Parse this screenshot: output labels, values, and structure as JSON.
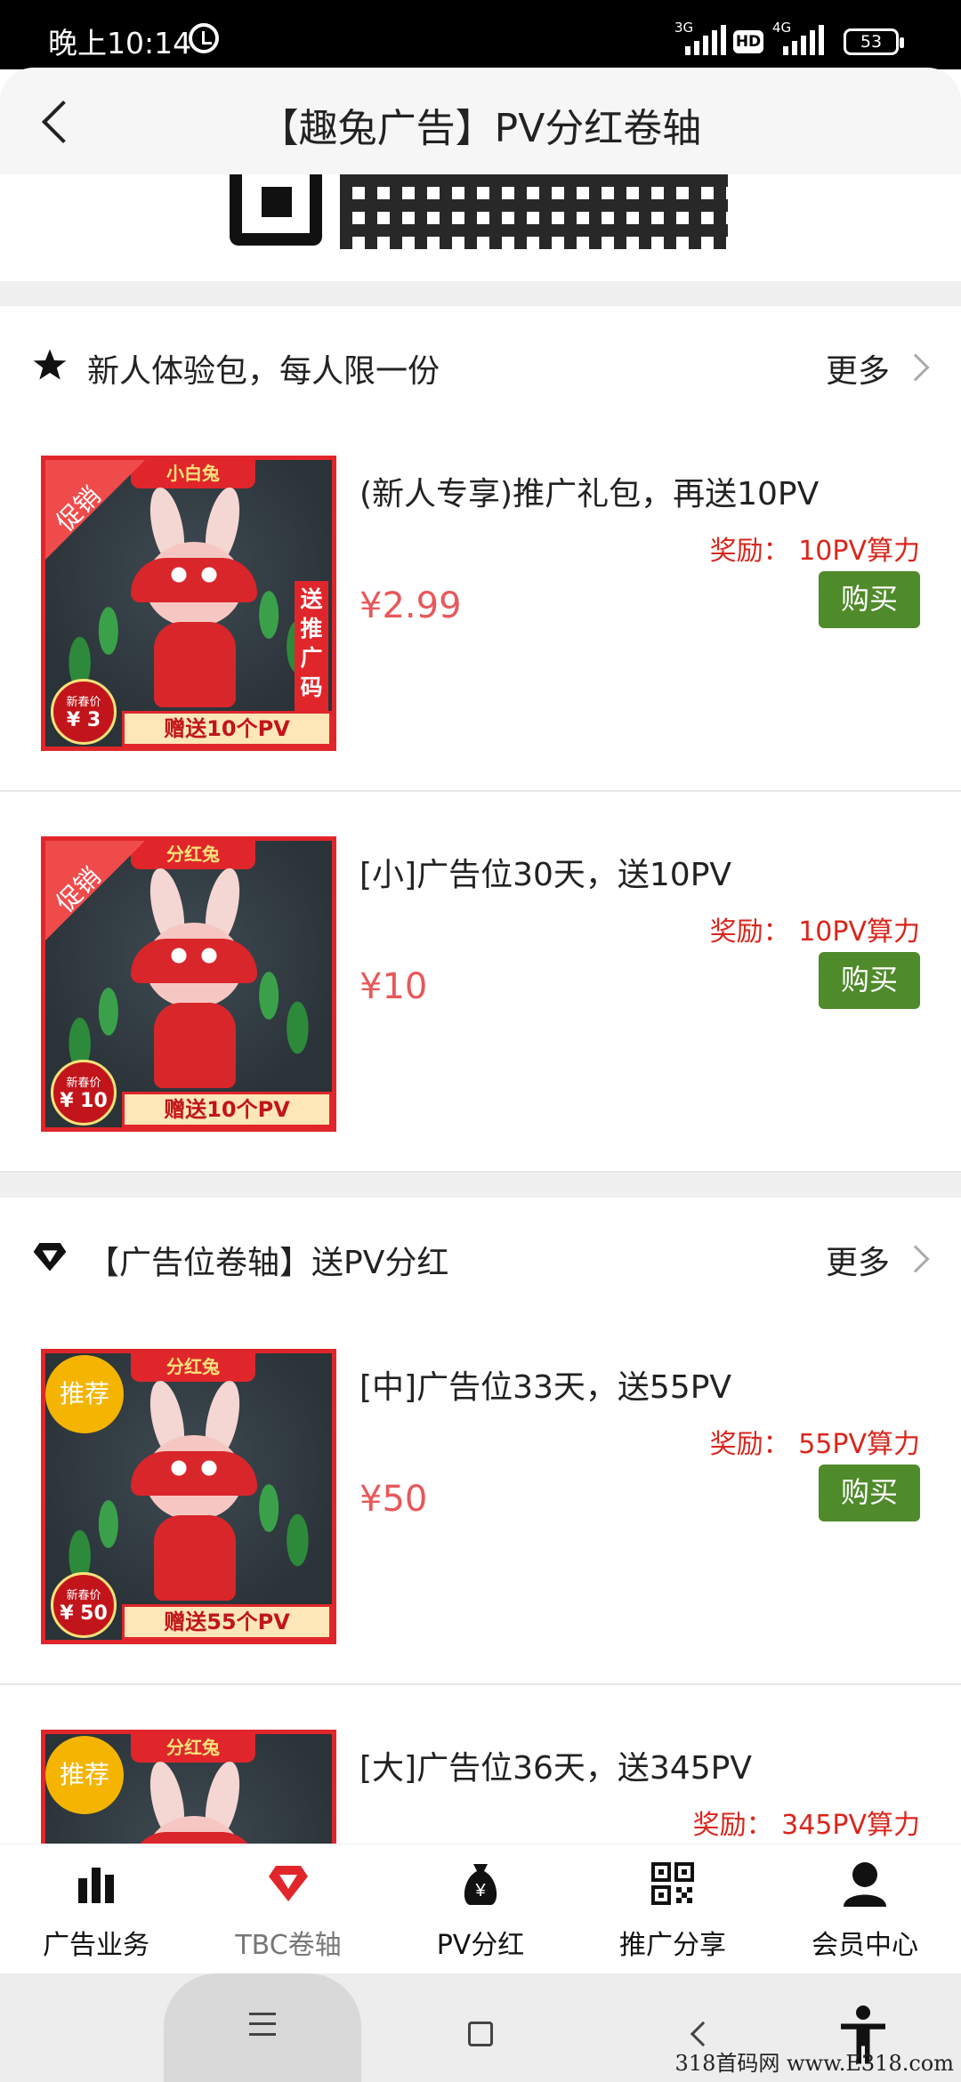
{
  "status_bar": {
    "time": "晚上10:14",
    "net1": "3G",
    "hd": "HD",
    "net2": "4G",
    "battery": "53"
  },
  "header": {
    "title": "【趣兔广告】PV分红卷轴"
  },
  "sections": [
    {
      "title": "新人体验包，每人限一份",
      "icon": "star-icon",
      "more": "更多",
      "products": [
        {
          "title": "(新人专享)推广礼包，再送10PV",
          "reward": "奖励：  10PV算力",
          "price": "¥2.99",
          "buy": "购买",
          "image": {
            "corner": "促销",
            "banner": "小白兔",
            "bottom": "赠送10个PV",
            "tag_label": "新春价",
            "tag_value": "¥ 3",
            "side": "送推广码"
          }
        },
        {
          "title": "[小]广告位30天，送10PV",
          "reward": "奖励：  10PV算力",
          "price": "¥10",
          "buy": "购买",
          "image": {
            "corner": "促销",
            "banner": "分红兔",
            "bottom": "赠送10个PV",
            "tag_label": "新春价",
            "tag_value": "¥ 10"
          }
        }
      ]
    },
    {
      "title": "【广告位卷轴】送PV分红",
      "icon": "diamond-icon",
      "more": "更多",
      "products": [
        {
          "title": "[中]广告位33天，送55PV",
          "reward": "奖励：  55PV算力",
          "price": "¥50",
          "buy": "购买",
          "image": {
            "badge": "推荐",
            "banner": "分红兔",
            "bottom": "赠送55个PV",
            "tag_label": "新春价",
            "tag_value": "¥ 50"
          }
        },
        {
          "title": "[大]广告位36天，送345PV",
          "reward": "奖励：  345PV算力",
          "image": {
            "badge": "推荐",
            "banner": "分红兔"
          }
        }
      ]
    }
  ],
  "bottom_nav": [
    {
      "label": "广告业务",
      "icon": "bar-chart-icon"
    },
    {
      "label": "TBC卷轴",
      "icon": "diamond-icon"
    },
    {
      "label": "PV分红",
      "icon": "money-bag-icon"
    },
    {
      "label": "推广分享",
      "icon": "qr-code-icon"
    },
    {
      "label": "会员中心",
      "icon": "person-icon"
    }
  ],
  "colors": {
    "accent_red": "#d9261c",
    "price_red": "#e8585a",
    "buy_green": "#4f8a2b",
    "active_tab": "#e0262b"
  },
  "watermark": "318首码网  www.E318.com"
}
